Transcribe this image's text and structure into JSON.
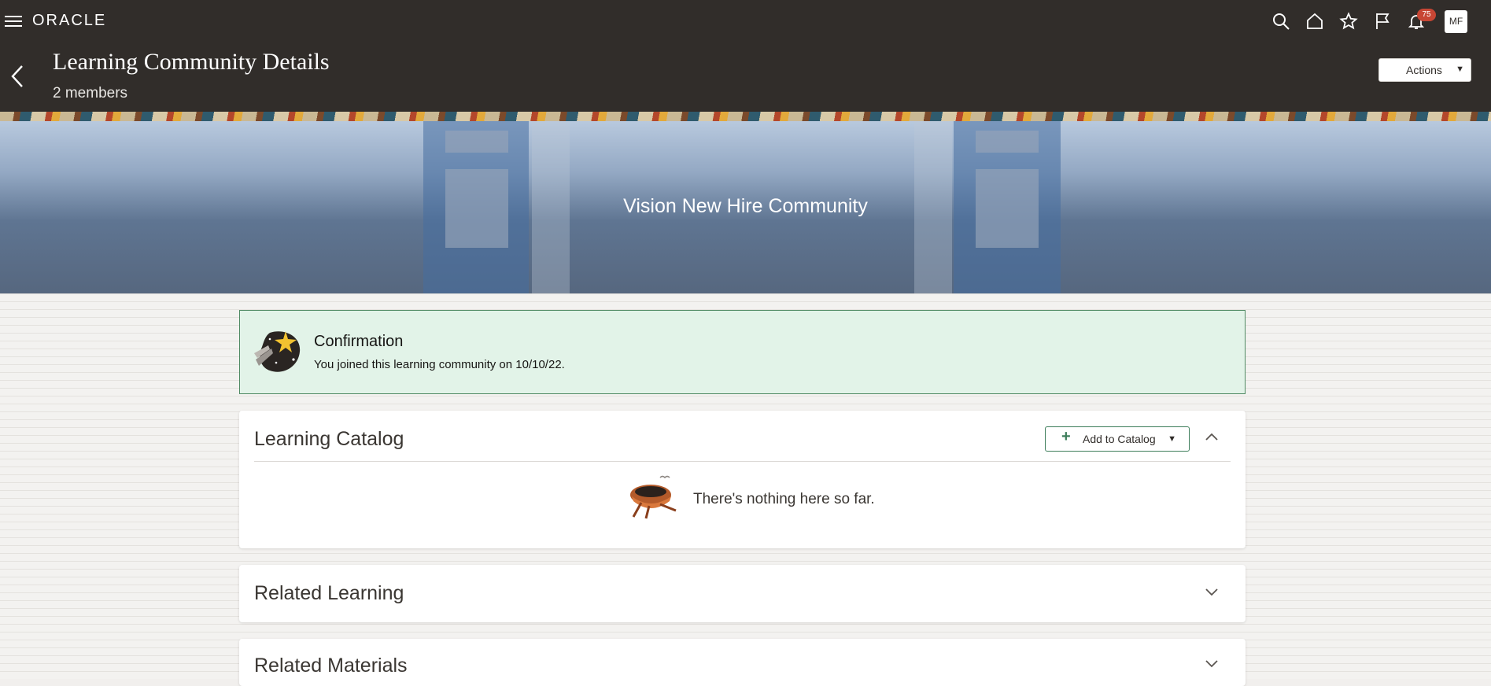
{
  "header": {
    "brand": "ORACLE",
    "notifications_count": "75",
    "avatar_initials": "MF",
    "icons": [
      "menu-icon",
      "search-icon",
      "home-icon",
      "favorites-star-icon",
      "flag-icon",
      "bell-icon"
    ]
  },
  "page": {
    "title": "Learning Community Details",
    "subtitle": "2 members",
    "actions_label": "Actions"
  },
  "banner": {
    "title": "Vision New Hire Community"
  },
  "confirmation": {
    "heading": "Confirmation",
    "message": "You joined this learning community on 10/10/22."
  },
  "learning_catalog": {
    "title": "Learning Catalog",
    "add_label": "Add to Catalog",
    "empty_message": "There's nothing here so far.",
    "expanded": true
  },
  "related_learning": {
    "title": "Related Learning",
    "expanded": false
  },
  "related_materials": {
    "title": "Related Materials",
    "expanded": false
  },
  "colors": {
    "header_bg": "#312d2a",
    "confirm_bg": "#e2f3e8",
    "confirm_border": "#4f8a63",
    "accent_green": "#3d7d5a",
    "badge_red": "#c74634"
  }
}
